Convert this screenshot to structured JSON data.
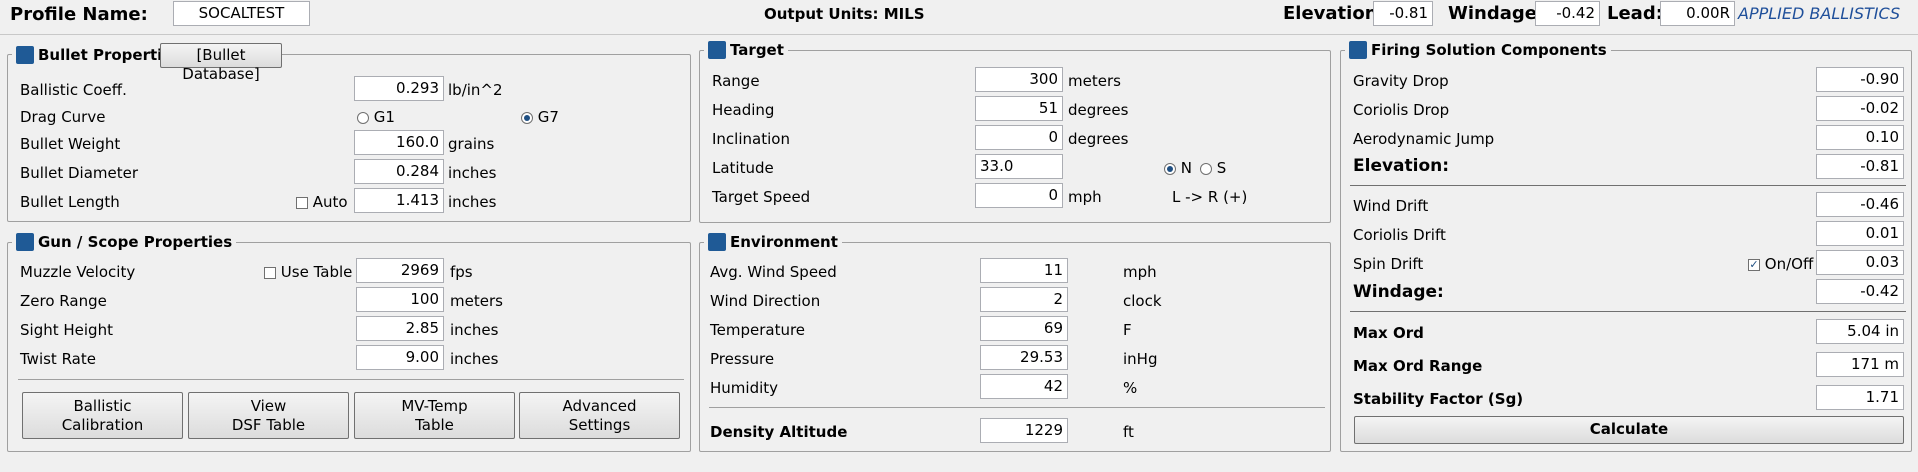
{
  "header": {
    "profile_label": "Profile Name:",
    "profile_value": "SOCALTEST",
    "output_units": "Output Units: MILS",
    "elevation_label": "Elevation:",
    "elevation_value": "-0.81",
    "windage_label": "Windage:",
    "windage_value": "-0.42",
    "lead_label": "Lead:",
    "lead_value": "0.00R",
    "brand": "APPLIED BALLISTICS"
  },
  "bullet": {
    "title": "Bullet Properties",
    "db_button": "[Bullet Database]",
    "bc_label": "Ballistic Coeff.",
    "bc_value": "0.293",
    "bc_unit": "lb/in^2",
    "drag_label": "Drag Curve",
    "g1": "G1",
    "g7": "G7",
    "weight_label": "Bullet Weight",
    "weight_value": "160.0",
    "weight_unit": "grains",
    "diameter_label": "Bullet Diameter",
    "diameter_value": "0.284",
    "diameter_unit": "inches",
    "length_label": "Bullet Length",
    "auto_label": "Auto",
    "length_value": "1.413",
    "length_unit": "inches"
  },
  "gun": {
    "title": "Gun / Scope  Properties",
    "mv_label": "Muzzle Velocity",
    "use_table": "Use Table",
    "mv_value": "2969",
    "mv_unit": "fps",
    "zero_label": "Zero Range",
    "zero_value": "100",
    "zero_unit": "meters",
    "sight_label": "Sight Height",
    "sight_value": "2.85",
    "sight_unit": "inches",
    "twist_label": "Twist Rate",
    "twist_value": "9.00",
    "twist_unit": "inches",
    "btn1_l1": "Ballistic",
    "btn1_l2": "Calibration",
    "btn2_l1": "View",
    "btn2_l2": "DSF Table",
    "btn3_l1": "MV-Temp",
    "btn3_l2": "Table",
    "btn4_l1": "Advanced",
    "btn4_l2": "Settings"
  },
  "target": {
    "title": "Target",
    "range_label": "Range",
    "range_value": "300",
    "range_unit": "meters",
    "heading_label": "Heading",
    "heading_value": "51",
    "heading_unit": "degrees",
    "incl_label": "Inclination",
    "incl_value": "0",
    "incl_unit": "degrees",
    "lat_label": "Latitude",
    "lat_value": "33.0",
    "n": "N",
    "s": "S",
    "speed_label": "Target Speed",
    "speed_value": "0",
    "speed_unit": "mph",
    "direction": "L -> R (+)"
  },
  "env": {
    "title": "Environment",
    "wind_label": "Avg. Wind Speed",
    "wind_value": "11",
    "wind_unit": "mph",
    "dir_label": "Wind Direction",
    "dir_value": "2",
    "dir_unit": "clock",
    "temp_label": "Temperature",
    "temp_value": "69",
    "temp_unit": "F",
    "press_label": "Pressure",
    "press_value": "29.53",
    "press_unit": "inHg",
    "hum_label": "Humidity",
    "hum_value": "42",
    "hum_unit": "%",
    "da_label": "Density Altitude",
    "da_value": "1229",
    "da_unit": "ft"
  },
  "solution": {
    "title": "Firing Solution Components",
    "gravity_label": "Gravity Drop",
    "gravity_value": "-0.90",
    "coriolis_drop_label": "Coriolis Drop",
    "coriolis_drop_value": "-0.02",
    "aero_label": "Aerodynamic Jump",
    "aero_value": "0.10",
    "elev_label": "Elevation:",
    "elev_value": "-0.81",
    "drift_label": "Wind Drift",
    "drift_value": "-0.46",
    "coriolis_drift_label": "Coriolis Drift",
    "coriolis_drift_value": "0.01",
    "spin_label": "Spin Drift",
    "onoff": "On/Off",
    "spin_value": "0.03",
    "wind_label": "Windage:",
    "wind_value": "-0.42",
    "maxord_label": "Max Ord",
    "maxord_value": "5.04 in",
    "maxordrange_label": "Max Ord Range",
    "maxordrange_value": "171 m",
    "stab_label": "Stability Factor (Sg)",
    "stab_value": "1.71",
    "calc": "Calculate"
  }
}
